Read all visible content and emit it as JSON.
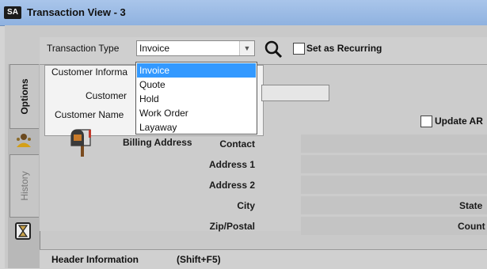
{
  "window": {
    "title": "Transaction View - 3",
    "logo_text": "SA"
  },
  "toolbar": {
    "transaction_type_label": "Transaction Type",
    "transaction_type_value": "Invoice",
    "recurring_label": "Set as Recurring"
  },
  "dropdown": {
    "options": [
      "Invoice",
      "Quote",
      "Hold",
      "Work Order",
      "Layaway"
    ],
    "selected_index": 0
  },
  "side_tabs": {
    "options": "Options",
    "history": "History"
  },
  "customer": {
    "group_label": "Customer Informa",
    "customer_label": "Customer",
    "customer_name_label": "Customer Name",
    "update_ar_label": "Update AR"
  },
  "address": {
    "billing_label": "Billing Address",
    "contact": "Contact",
    "address1": "Address 1",
    "address2": "Address 2",
    "city": "City",
    "zip": "Zip/Postal",
    "state": "State",
    "country": "Count"
  },
  "header": {
    "label": "Header Information",
    "shortcut": "(Shift+F5)"
  },
  "colors": {
    "selected": "#3399ff",
    "title_bar": "#9dbce6"
  }
}
